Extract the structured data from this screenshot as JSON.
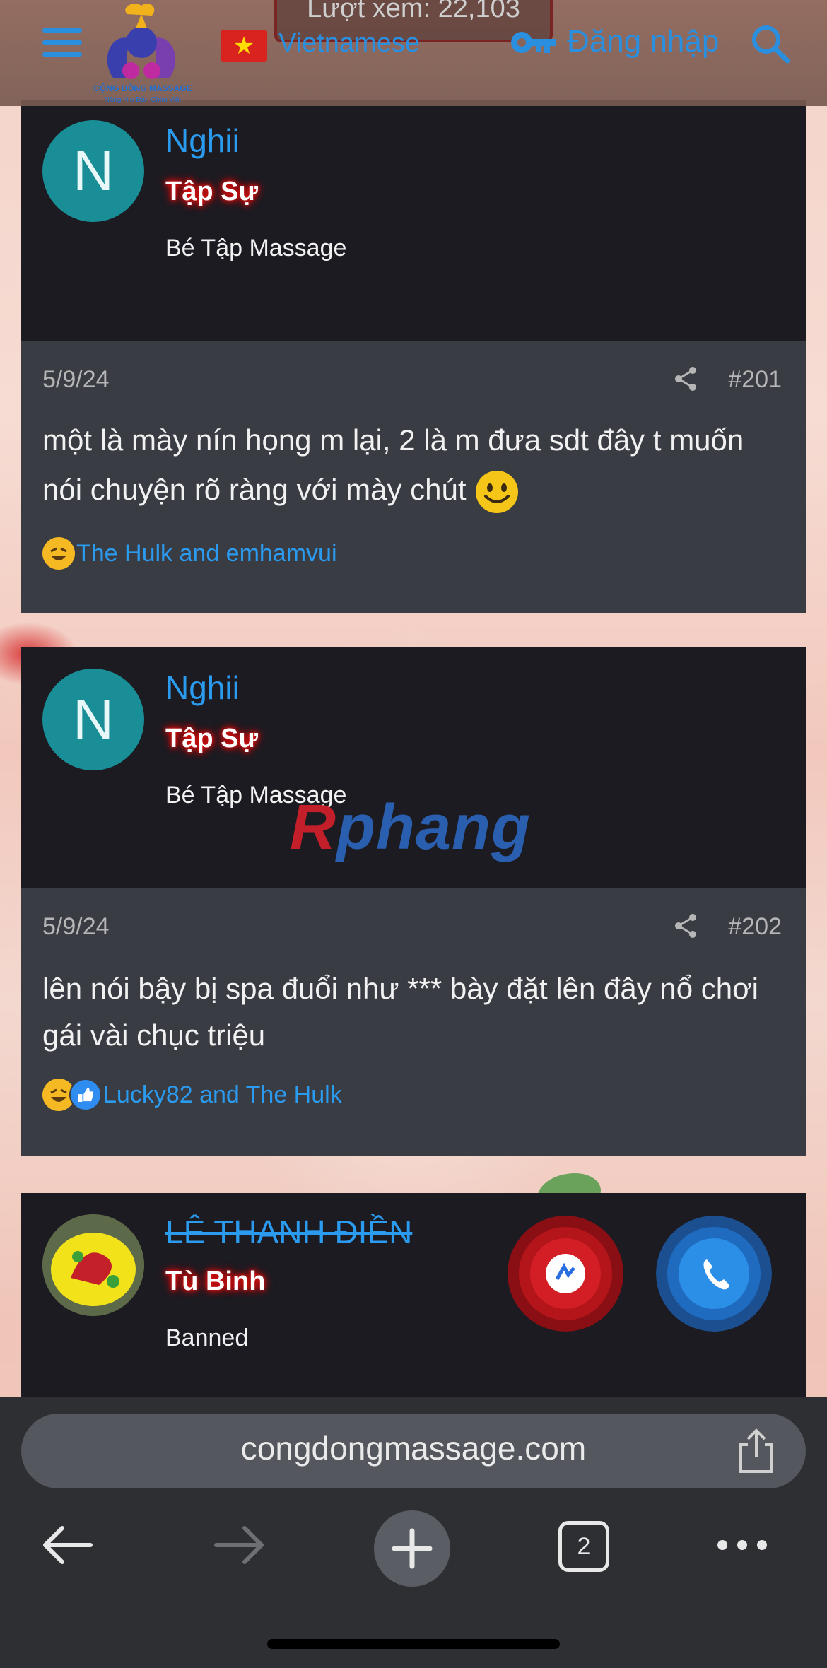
{
  "header": {
    "views_text": "Lượt xem: 22,103",
    "logo_title": "CỘNG ĐỒNG MASSAGE",
    "logo_subtitle": "Nâng Niu Đàn Chim Việt",
    "language": "Vietnamese",
    "login_label": "Đăng nhập"
  },
  "posts": [
    {
      "avatar_letter": "N",
      "username": "Nghii",
      "rank": "Tập Sự",
      "user_title": "Bé Tập Massage",
      "date": "5/9/24",
      "number": "#201",
      "content": "một là mày nín họng m lại, 2 là m đưa sdt đây t muốn nói chuyện rõ ràng với mày chút",
      "reactions": "The Hulk and emhamvui"
    },
    {
      "avatar_letter": "N",
      "username": "Nghii",
      "rank": "Tập Sự",
      "user_title": "Bé Tập Massage",
      "date": "5/9/24",
      "number": "#202",
      "content": "lên nói bậy bị spa đuổi như *** bày đặt lên đây nổ chơi gái vài chục triệu",
      "reactions": "Lucky82 and The Hulk"
    },
    {
      "username": "LÊ THANH ĐIỀN",
      "rank": "Tù Binh",
      "user_title": "Banned"
    }
  ],
  "watermark": {
    "part1": "R",
    "part2": "phang"
  },
  "browser": {
    "url": "congdongmassage.com",
    "tab_count": "2"
  },
  "colors": {
    "accent": "#2b9bf0",
    "post_header_bg": "#1c1b22",
    "post_body_bg": "#3a3c44",
    "rank_glow": "#e01010"
  }
}
